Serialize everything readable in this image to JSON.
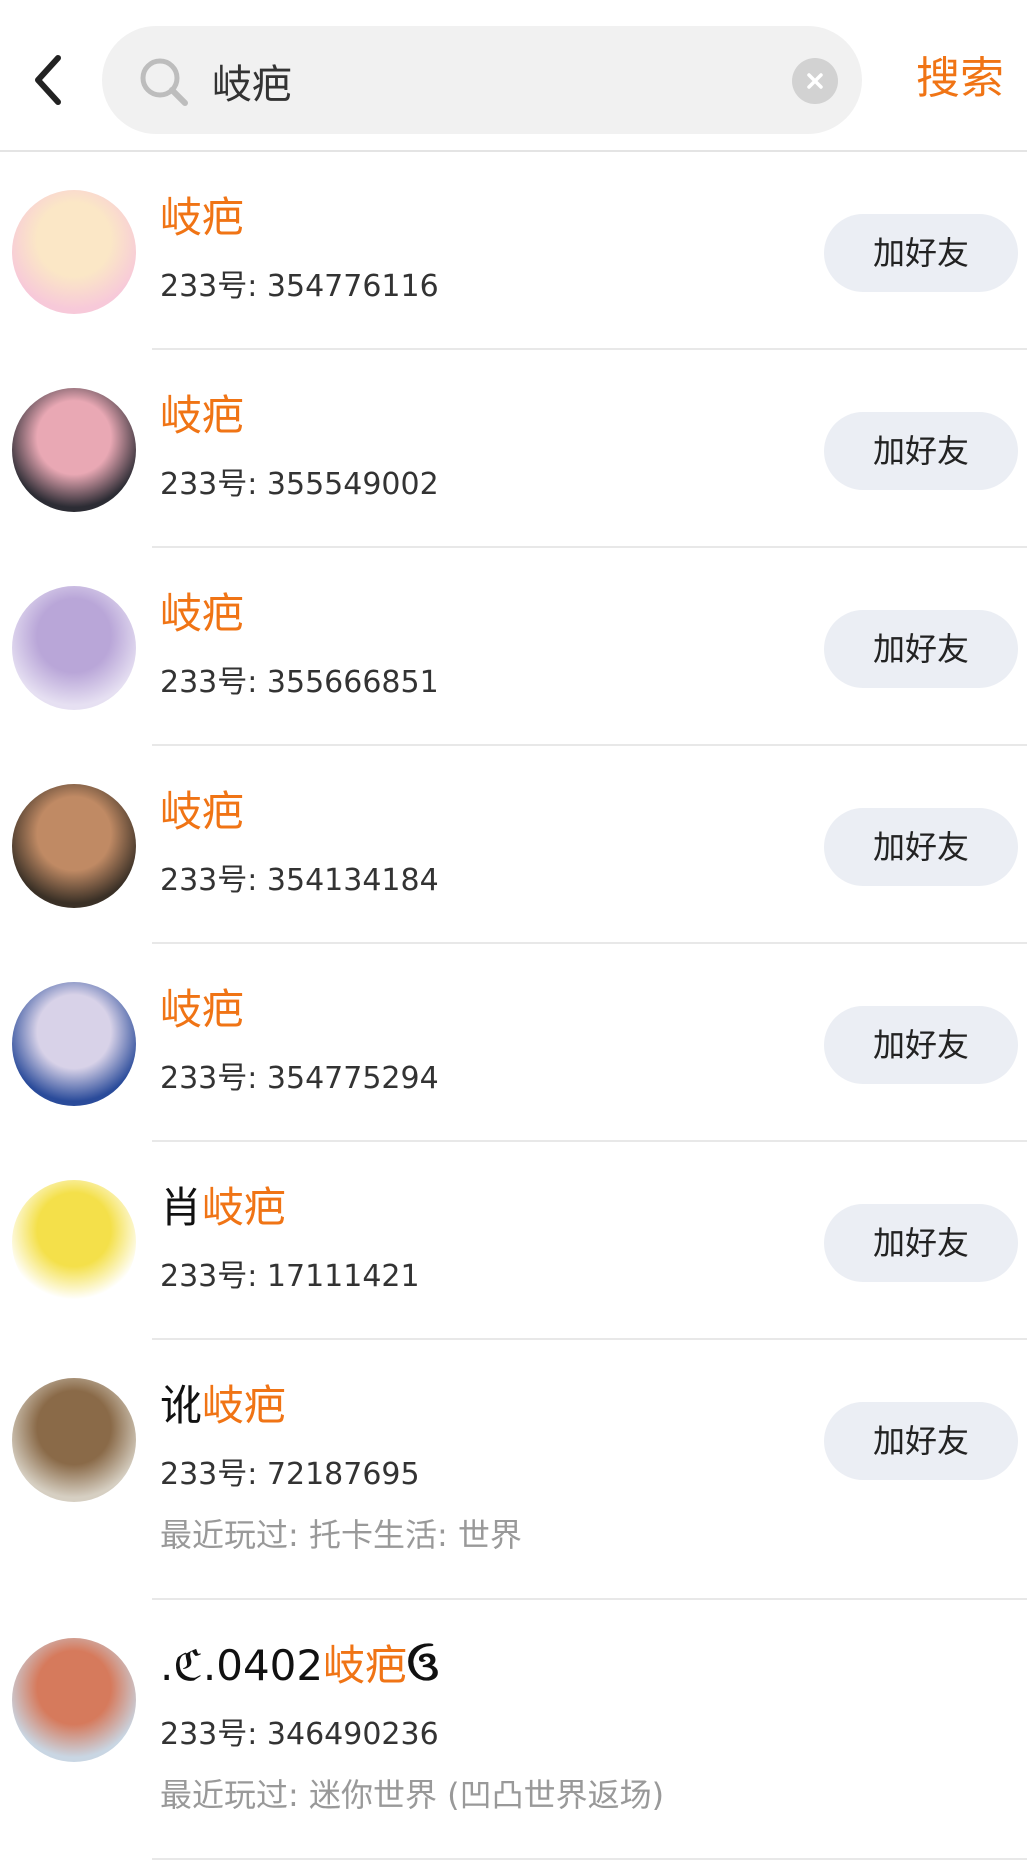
{
  "header": {
    "search_value": "岐疤",
    "search_button": "搜索"
  },
  "results": [
    {
      "name_prefix": "",
      "name_highlight": "岐疤",
      "name_suffix": "",
      "id_label": "233号: 354776116",
      "recent": "",
      "add_label": "加好友",
      "avatar_colors": [
        "#f7c9d9",
        "#fbe7c6"
      ]
    },
    {
      "name_prefix": "",
      "name_highlight": "岐疤",
      "name_suffix": "",
      "id_label": "233号: 355549002",
      "recent": "",
      "add_label": "加好友",
      "avatar_colors": [
        "#2c2c34",
        "#e9a8b4"
      ]
    },
    {
      "name_prefix": "",
      "name_highlight": "岐疤",
      "name_suffix": "",
      "id_label": "233号: 355666851",
      "recent": "",
      "add_label": "加好友",
      "avatar_colors": [
        "#e6e0f2",
        "#b9a6d8"
      ]
    },
    {
      "name_prefix": "",
      "name_highlight": "岐疤",
      "name_suffix": "",
      "id_label": "233号: 354134184",
      "recent": "",
      "add_label": "加好友",
      "avatar_colors": [
        "#3a3026",
        "#c08a64"
      ]
    },
    {
      "name_prefix": "",
      "name_highlight": "岐疤",
      "name_suffix": "",
      "id_label": "233号: 354775294",
      "recent": "",
      "add_label": "加好友",
      "avatar_colors": [
        "#2a4b9a",
        "#d8d2e8"
      ]
    },
    {
      "name_prefix": "肖",
      "name_highlight": "岐疤",
      "name_suffix": "",
      "id_label": "233号: 17111421",
      "recent": "",
      "add_label": "加好友",
      "avatar_colors": [
        "#ffffff",
        "#f4e04a"
      ]
    },
    {
      "name_prefix": "讹",
      "name_highlight": "岐疤",
      "name_suffix": "",
      "id_label": "233号: 72187695",
      "recent": "最近玩过: 托卡生活: 世界",
      "add_label": "加好友",
      "avatar_colors": [
        "#d6cfc2",
        "#8a6a48"
      ]
    },
    {
      "name_prefix": ".ℭ.0402",
      "name_highlight": "岐疤",
      "name_suffix": "ઉ",
      "id_label": "233号: 346490236",
      "recent": "最近玩过: 迷你世界 (凹凸世界返场)",
      "add_label": "",
      "avatar_colors": [
        "#c9d6e3",
        "#d67a5c"
      ]
    }
  ]
}
